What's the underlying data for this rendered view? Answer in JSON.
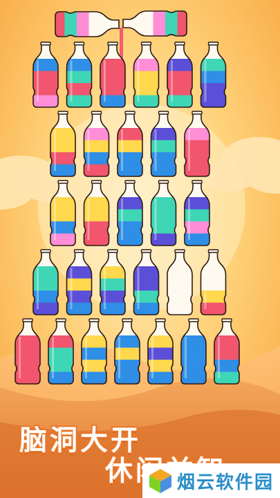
{
  "game": {
    "headline_line1": "脑洞大开",
    "headline_line2": "休闲益智",
    "colors": {
      "R": "#f2556e",
      "T": "#3fd6b6",
      "B": "#2f8ee6",
      "P": "#5b4fd8",
      "Y": "#ffd84d",
      "K": "#ff8ed6",
      "O": "#ee8a4f"
    },
    "pour": {
      "left_bottle_layers": [
        "R",
        "T",
        "K"
      ],
      "right_bottle_layers": [
        "R",
        "T",
        "K"
      ],
      "stream_color": "R"
    },
    "bottle_rows": [
      [
        [
          "K",
          "R",
          "R",
          "B"
        ],
        [
          "T",
          "R",
          "T",
          "B"
        ],
        [
          "B",
          "R",
          "R",
          "R"
        ],
        [
          "T",
          "Y",
          "Y",
          "K"
        ],
        [
          "T",
          "R",
          "R",
          "P"
        ],
        [
          "P",
          "P",
          "B",
          "T"
        ]
      ],
      [
        [
          "B",
          "R",
          "Y",
          "Y"
        ],
        [
          "R",
          "B",
          "Y",
          "K"
        ],
        [
          "B",
          "B",
          "Y",
          "R"
        ],
        [
          "B",
          "B",
          "T",
          "P"
        ],
        [
          "R",
          "R",
          "R",
          "K"
        ]
      ],
      [
        [
          "K",
          "B",
          "Y",
          "Y"
        ],
        [
          "R",
          "R",
          "Y",
          "Y"
        ],
        [
          "B",
          "B",
          "T",
          "P"
        ],
        [
          "P",
          "T",
          "T",
          "T"
        ],
        [
          "B",
          "K",
          "T",
          "P"
        ]
      ],
      [
        [
          "P",
          "B",
          "T",
          "T"
        ],
        [
          "B",
          "P",
          "Y",
          "P"
        ],
        [
          "B",
          "P",
          "T",
          "Y"
        ],
        [
          "B",
          "T",
          "P",
          "P"
        ],
        [],
        [
          "R",
          "Y"
        ]
      ],
      [
        [
          "R",
          "R",
          "R",
          "R"
        ],
        [
          "B",
          "T",
          "T",
          "R"
        ],
        [
          "B",
          "Y",
          "B",
          "Y"
        ],
        [
          "B",
          "B",
          "Y",
          "B"
        ],
        [
          "B",
          "Y",
          "P",
          "Y"
        ],
        [
          "B",
          "B",
          "B",
          "B"
        ],
        [
          "T",
          "B",
          "R",
          "R"
        ]
      ]
    ]
  },
  "watermark": {
    "text": "烟云软件园",
    "logo": "cube-logo",
    "logo_colors": [
      "#f5a623",
      "#7ed321",
      "#4a90e2"
    ]
  }
}
